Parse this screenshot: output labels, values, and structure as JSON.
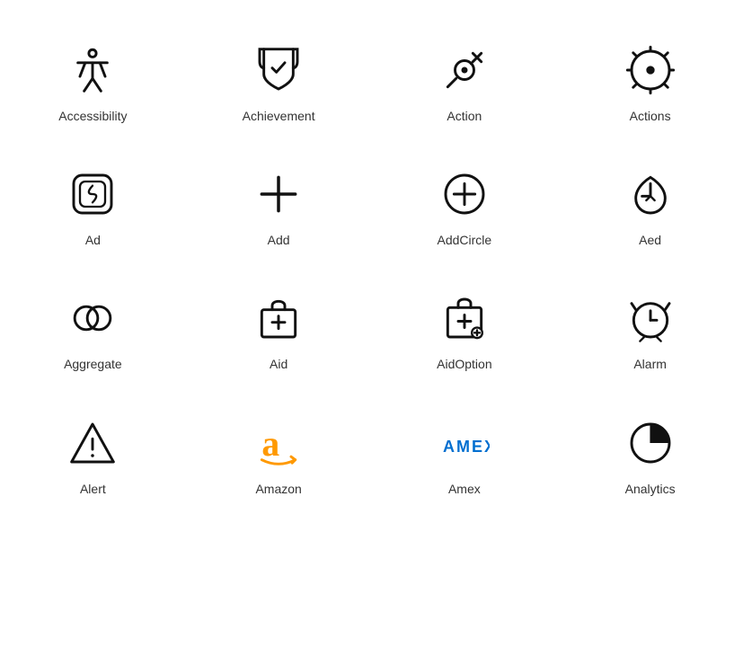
{
  "icons": [
    {
      "name": "Accessibility",
      "id": "accessibility-icon"
    },
    {
      "name": "Achievement",
      "id": "achievement-icon"
    },
    {
      "name": "Action",
      "id": "action-icon"
    },
    {
      "name": "Actions",
      "id": "actions-icon"
    },
    {
      "name": "Ad",
      "id": "ad-icon"
    },
    {
      "name": "Add",
      "id": "add-icon"
    },
    {
      "name": "AddCircle",
      "id": "addcircle-icon"
    },
    {
      "name": "Aed",
      "id": "aed-icon"
    },
    {
      "name": "Aggregate",
      "id": "aggregate-icon"
    },
    {
      "name": "Aid",
      "id": "aid-icon"
    },
    {
      "name": "AidOption",
      "id": "aidoption-icon"
    },
    {
      "name": "Alarm",
      "id": "alarm-icon"
    },
    {
      "name": "Alert",
      "id": "alert-icon"
    },
    {
      "name": "Amazon",
      "id": "amazon-icon"
    },
    {
      "name": "Amex",
      "id": "amex-icon"
    },
    {
      "name": "Analytics",
      "id": "analytics-icon"
    }
  ]
}
